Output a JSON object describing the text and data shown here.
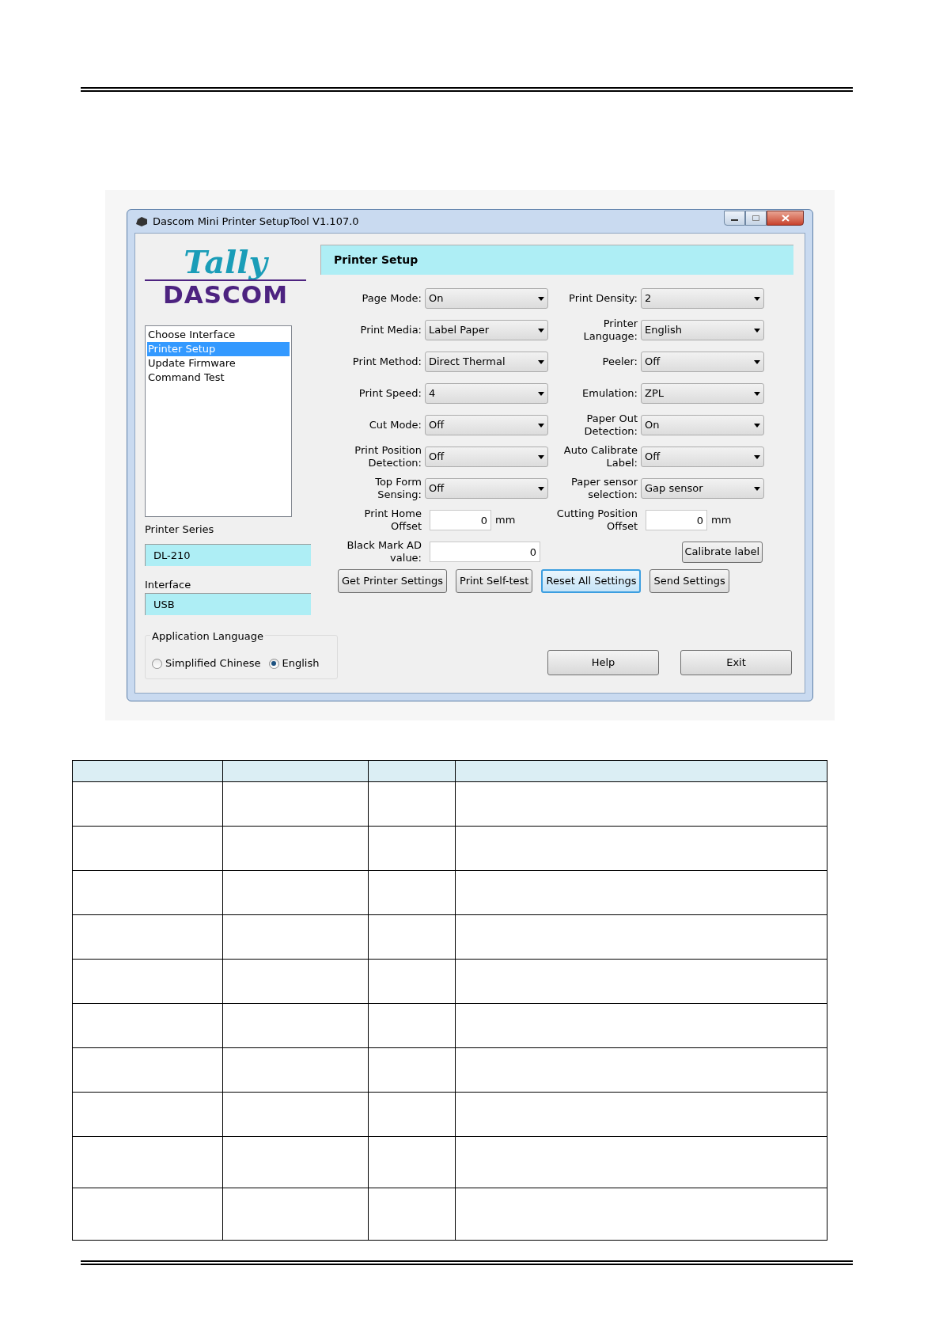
{
  "window": {
    "title": "Dascom Mini Printer SetupTool V1.107.0"
  },
  "logo": {
    "top": "Tally",
    "bottom": "DASCOM"
  },
  "nav": {
    "items": [
      {
        "label": "Choose Interface",
        "selected": false
      },
      {
        "label": "Printer Setup",
        "selected": true
      },
      {
        "label": "Update Firmware",
        "selected": false
      },
      {
        "label": "Command Test",
        "selected": false
      }
    ]
  },
  "printer_series": {
    "label": "Printer Series",
    "value": "DL-210"
  },
  "interface": {
    "label": "Interface",
    "value": "USB"
  },
  "app_language": {
    "label": "Application Language",
    "options": [
      {
        "label": "Simplified Chinese",
        "selected": false
      },
      {
        "label": "English",
        "selected": true
      }
    ]
  },
  "panel": {
    "title": "Printer Setup"
  },
  "left_fields": [
    {
      "kind": "dropdown",
      "label": "Page Mode:",
      "value": "On"
    },
    {
      "kind": "dropdown",
      "label": "Print Media:",
      "value": "Label Paper"
    },
    {
      "kind": "dropdown",
      "label": "Print Method:",
      "value": "Direct Thermal"
    },
    {
      "kind": "dropdown",
      "label": "Print Speed:",
      "value": "4"
    },
    {
      "kind": "dropdown",
      "label": "Cut Mode:",
      "value": "Off"
    },
    {
      "kind": "dropdown",
      "label": "Print Position\nDetection:",
      "value": "Off"
    },
    {
      "kind": "dropdown",
      "label": "Top Form\nSensing:",
      "value": "Off"
    },
    {
      "kind": "number",
      "label": "Print Home\nOffset",
      "value": "0",
      "unit": "mm"
    },
    {
      "kind": "wide_number",
      "label": "Black Mark AD\nvalue:",
      "value": "0"
    }
  ],
  "right_fields": [
    {
      "kind": "dropdown",
      "label": "Print Density:",
      "value": "2"
    },
    {
      "kind": "dropdown",
      "label": "Printer\nLanguage:",
      "value": "English"
    },
    {
      "kind": "dropdown",
      "label": "Peeler:",
      "value": "Off"
    },
    {
      "kind": "dropdown",
      "label": "Emulation:",
      "value": "ZPL"
    },
    {
      "kind": "dropdown",
      "label": "Paper Out\nDetection:",
      "value": "On"
    },
    {
      "kind": "dropdown",
      "label": "Auto Calibrate\nLabel:",
      "value": "Off"
    },
    {
      "kind": "dropdown",
      "label": "Paper sensor\nselection:",
      "value": "Gap sensor"
    },
    {
      "kind": "number",
      "label": "Cutting Position\nOffset",
      "value": "0",
      "unit": "mm"
    },
    {
      "kind": "button",
      "label": "Calibrate label"
    }
  ],
  "action_buttons": [
    {
      "label": "Get Printer Settings",
      "focused": false
    },
    {
      "label": "Print Self-test",
      "focused": false
    },
    {
      "label": "Reset All Settings",
      "focused": true
    },
    {
      "label": "Send Settings",
      "focused": false
    }
  ],
  "footer_buttons": [
    {
      "label": "Help"
    },
    {
      "label": "Exit"
    }
  ]
}
